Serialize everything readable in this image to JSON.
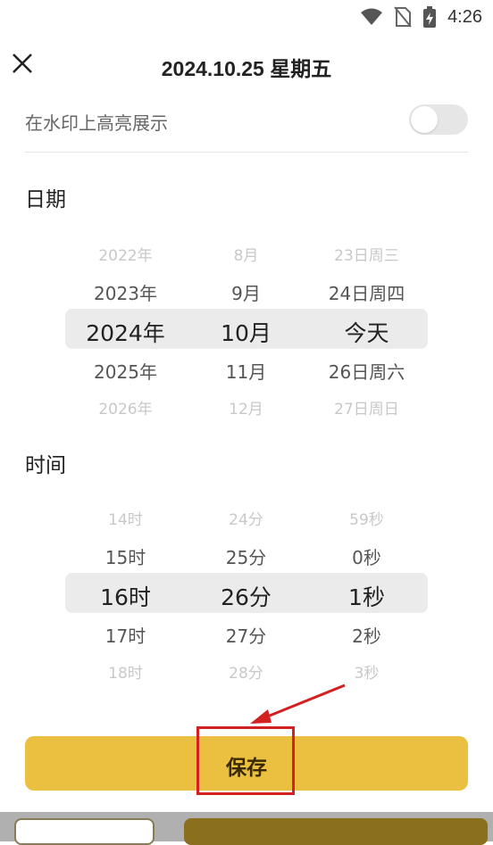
{
  "status_bar": {
    "time": "4:26"
  },
  "header": {
    "title": "2024.10.25 星期五"
  },
  "highlight": {
    "label": "在水印上高亮展示",
    "enabled": false
  },
  "date_section": {
    "label": "日期",
    "columns": [
      [
        "2022年",
        "2023年",
        "2024年",
        "2025年",
        "2026年"
      ],
      [
        "8月",
        "9月",
        "10月",
        "11月",
        "12月"
      ],
      [
        "23日周三",
        "24日周四",
        "今天",
        "26日周六",
        "27日周日"
      ]
    ]
  },
  "time_section": {
    "label": "时间",
    "columns": [
      [
        "14时",
        "15时",
        "16时",
        "17时",
        "18时"
      ],
      [
        "24分",
        "25分",
        "26分",
        "27分",
        "28分"
      ],
      [
        "59秒",
        "0秒",
        "1秒",
        "2秒",
        "3秒"
      ]
    ]
  },
  "save_button": {
    "label": "保存"
  },
  "colors": {
    "accent": "#ebbf3f",
    "annotation": "#d32020",
    "band": "#ebebeb"
  }
}
